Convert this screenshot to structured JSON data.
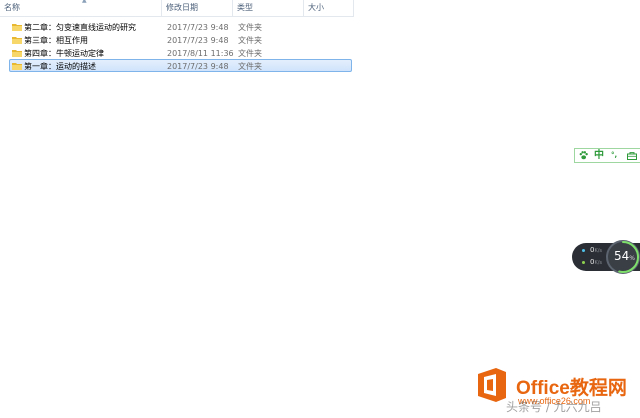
{
  "columns": [
    {
      "key": "name",
      "label": "名称"
    },
    {
      "key": "modified",
      "label": "修改日期"
    },
    {
      "key": "type",
      "label": "类型"
    },
    {
      "key": "size",
      "label": "大小"
    }
  ],
  "files": [
    {
      "name": "第二章：匀变速直线运动的研究",
      "modified": "2017/7/23 9:48",
      "type": "文件夹",
      "size": "",
      "selected": false
    },
    {
      "name": "第三章：相互作用",
      "modified": "2017/7/23 9:48",
      "type": "文件夹",
      "size": "",
      "selected": false
    },
    {
      "name": "第四章：牛顿运动定律",
      "modified": "2017/8/11 11:36",
      "type": "文件夹",
      "size": "",
      "selected": false
    },
    {
      "name": "第一章：运动的描述",
      "modified": "2017/7/23 9:48",
      "type": "文件夹",
      "size": "",
      "selected": true
    }
  ],
  "ime": {
    "mode": "中",
    "punct": "°,",
    "icon": "paw-icon",
    "accent": "#2e9a3a"
  },
  "net_monitor": {
    "upload_value": "0",
    "upload_unit": "K/s",
    "download_value": "0",
    "download_unit": "K/s",
    "percent": "54",
    "percent_unit": "%"
  },
  "watermark": {
    "title": "Office教程网",
    "url": "www.office26.com",
    "credit": "头条号 / 九六九吕",
    "accent": "#e8660f"
  }
}
